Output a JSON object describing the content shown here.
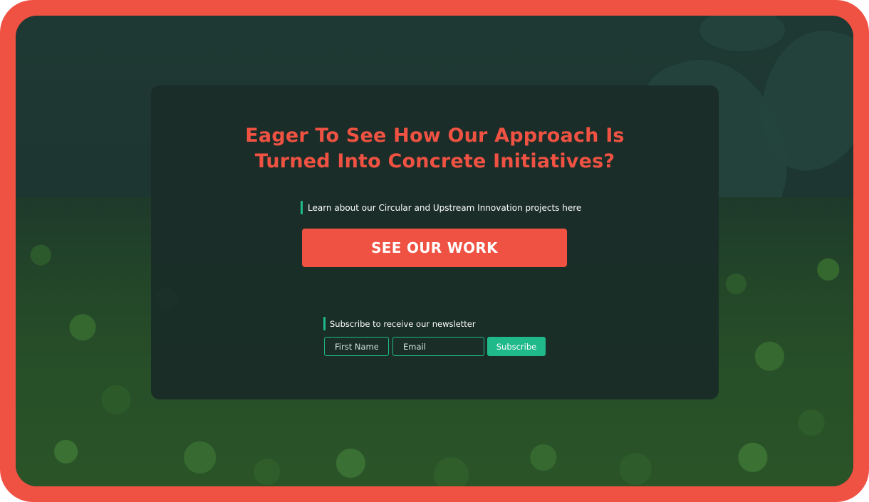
{
  "hero": {
    "headline_line1": "Eager To See How Our Approach Is",
    "headline_line2": "Turned Into Concrete Initiatives?",
    "lead_text": "Learn about our Circular and Upstream Innovation projects here",
    "cta_label": "SEE OUR WORK"
  },
  "newsletter": {
    "label": "Subscribe to receive our newsletter",
    "first_name_placeholder": "First Name",
    "email_placeholder": "Email",
    "subscribe_label": "Subscribe"
  },
  "colors": {
    "accent": "#ef5242",
    "secondary": "#1fb98a",
    "card": "#1a2c28"
  }
}
